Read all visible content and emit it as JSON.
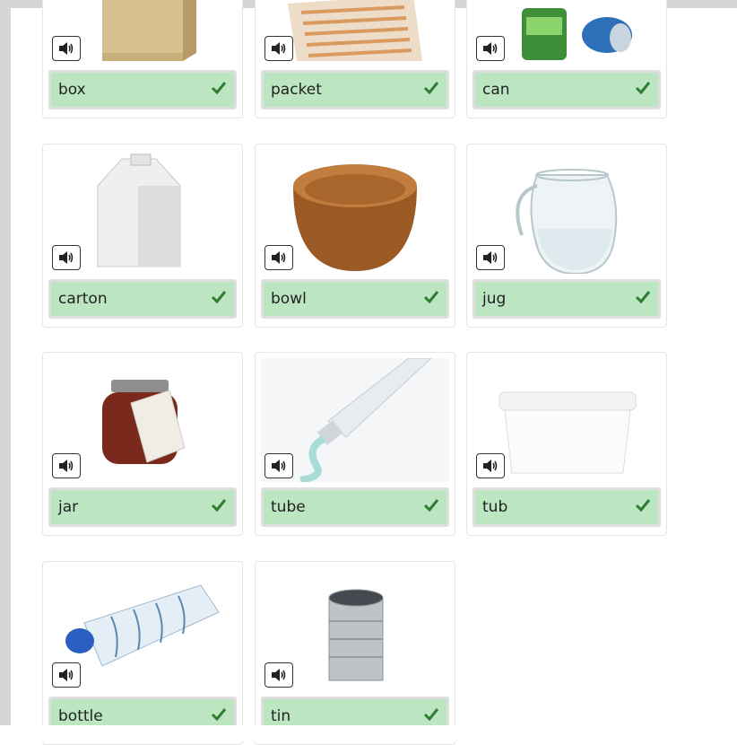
{
  "items": [
    {
      "word": "box",
      "image": "box-image",
      "status": "correct"
    },
    {
      "word": "packet",
      "image": "packet-image",
      "status": "correct"
    },
    {
      "word": "can",
      "image": "can-image",
      "status": "correct"
    },
    {
      "word": "carton",
      "image": "carton-image",
      "status": "correct"
    },
    {
      "word": "bowl",
      "image": "bowl-image",
      "status": "correct"
    },
    {
      "word": "jug",
      "image": "jug-image",
      "status": "correct"
    },
    {
      "word": "jar",
      "image": "jar-image",
      "status": "correct"
    },
    {
      "word": "tube",
      "image": "tube-image",
      "status": "correct"
    },
    {
      "word": "tub",
      "image": "tub-image",
      "status": "correct"
    },
    {
      "word": "bottle",
      "image": "bottle-image",
      "status": "correct"
    },
    {
      "word": "tin",
      "image": "tin-image",
      "status": "correct"
    }
  ],
  "icons": {
    "sound": "speaker-icon",
    "correct": "check-icon"
  },
  "colors": {
    "correct_bg": "#bce6c2",
    "check": "#2e7d32",
    "frame": "#d6d6d6"
  }
}
